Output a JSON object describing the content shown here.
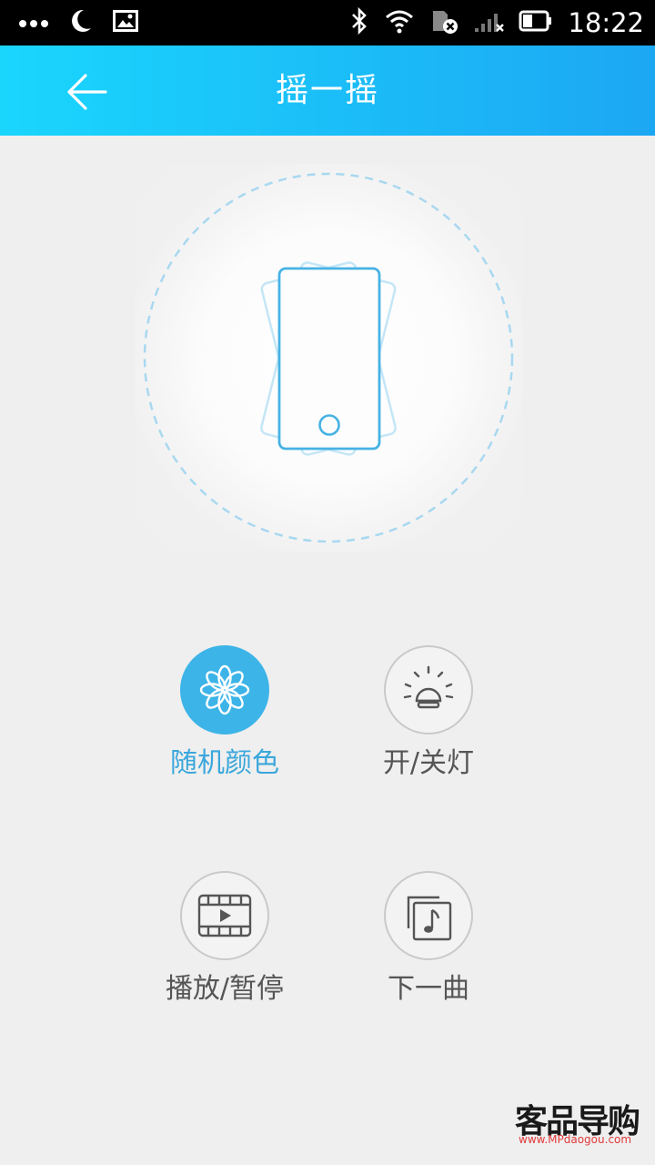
{
  "status_bar": {
    "time": "18:22",
    "icons": [
      "more-dots-icon",
      "moon-icon",
      "image-icon",
      "bluetooth-icon",
      "wifi-icon",
      "sim-card-icon",
      "signal-icon",
      "battery-icon"
    ]
  },
  "header": {
    "title": "摇一摇",
    "back_icon": "arrow-left-icon"
  },
  "shake_area": {
    "icon": "shaking-phone-icon"
  },
  "actions": [
    {
      "label": "随机颜色",
      "icon": "flower-icon",
      "active": true
    },
    {
      "label": "开/关灯",
      "icon": "light-bulb-icon",
      "active": false
    },
    {
      "label": "播放/暂停",
      "icon": "video-play-icon",
      "active": false
    },
    {
      "label": "下一曲",
      "icon": "music-note-icon",
      "active": false
    }
  ],
  "watermark": {
    "brand": "客品导购",
    "url": "www.MPdaogou.com"
  },
  "colors": {
    "accent": "#3db4e8",
    "appbar_start": "#1ad6fd",
    "appbar_end": "#1ca7f3",
    "background": "#efefef"
  }
}
